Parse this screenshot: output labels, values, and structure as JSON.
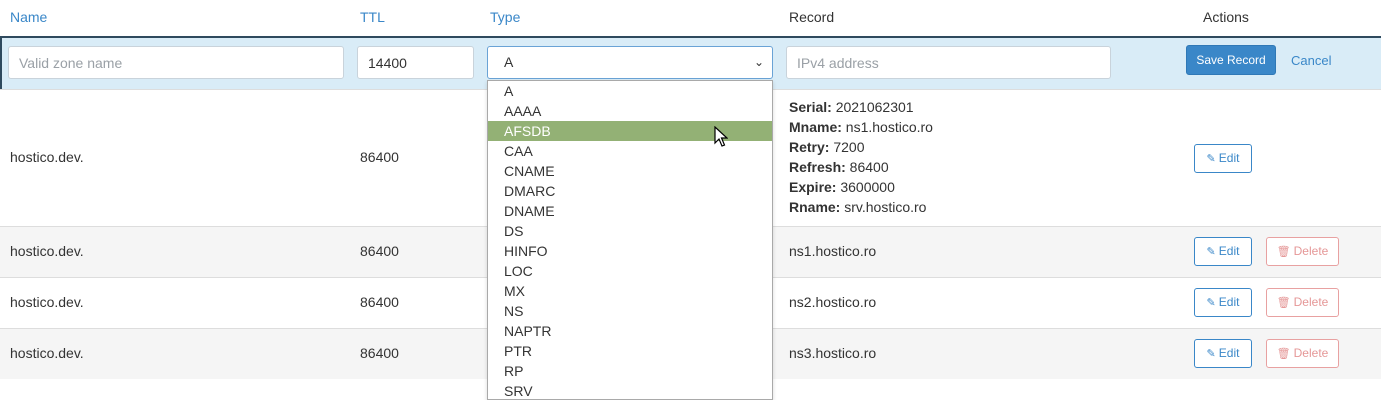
{
  "headers": {
    "name": "Name",
    "ttl": "TTL",
    "type": "Type",
    "record": "Record",
    "actions": "Actions"
  },
  "new_record": {
    "name_placeholder": "Valid zone name",
    "ttl_value": "14400",
    "type_selected": "A",
    "record_placeholder": "IPv4 address",
    "save_label": "Save Record",
    "cancel_label": "Cancel"
  },
  "type_options": [
    "A",
    "AAAA",
    "AFSDB",
    "CAA",
    "CNAME",
    "DMARC",
    "DNAME",
    "DS",
    "HINFO",
    "LOC",
    "MX",
    "NS",
    "NAPTR",
    "PTR",
    "RP",
    "SRV"
  ],
  "highlighted_option": "AFSDB",
  "rows": [
    {
      "name": "hostico.dev.",
      "ttl": "86400",
      "soa": [
        {
          "label": "Serial:",
          "value": " 2021062301"
        },
        {
          "label": "Mname:",
          "value": " ns1.hostico.ro"
        },
        {
          "label": "Retry:",
          "value": " 7200"
        },
        {
          "label": "Refresh:",
          "value": " 86400"
        },
        {
          "label": "Expire:",
          "value": " 3600000"
        },
        {
          "label": "Rname:",
          "value": " srv.hostico.ro"
        }
      ],
      "edit_label": "Edit"
    },
    {
      "name": "hostico.dev.",
      "ttl": "86400",
      "record": "ns1.hostico.ro",
      "edit_label": "Edit",
      "delete_label": "Delete"
    },
    {
      "name": "hostico.dev.",
      "ttl": "86400",
      "record": "ns2.hostico.ro",
      "edit_label": "Edit",
      "delete_label": "Delete"
    },
    {
      "name": "hostico.dev.",
      "ttl": "86400",
      "record": "ns3.hostico.ro",
      "edit_label": "Edit",
      "delete_label": "Delete"
    }
  ],
  "colors": {
    "accent": "#3a87c8",
    "danger": "#e59797",
    "highlight": "#93b175",
    "edit_row_bg": "#d9ecf7"
  },
  "icons": {
    "edit": "pencil-icon",
    "delete": "trash-icon",
    "select": "chevron-down-icon"
  }
}
